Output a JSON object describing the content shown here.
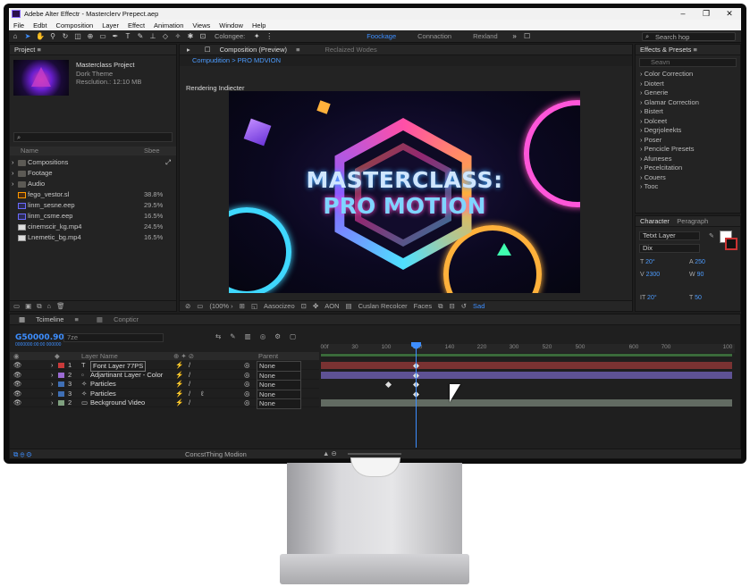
{
  "window": {
    "title": "Adebe Alter Effectr - Masterclerv Prepect.aep"
  },
  "menu": [
    "File",
    "Edbt",
    "Composition",
    "Layer",
    "Effect",
    "Animation",
    "Views",
    "Window",
    "Help"
  ],
  "toolbar": {
    "collapse_label": "Colongee:",
    "workspaces": [
      "Foockage",
      "Connaction",
      "Rexland"
    ],
    "search_help": "Search hop"
  },
  "project": {
    "panel_title": "Project",
    "name": "Masterclass Project",
    "line2": "Dork Theme",
    "line3": "Resclution.: 12:10 MB",
    "search": "",
    "col_name": "Name",
    "col_size": "Sbee",
    "items": [
      {
        "name": "Compositions",
        "size": "",
        "type": "folder"
      },
      {
        "name": "Footage",
        "size": "",
        "type": "folder"
      },
      {
        "name": "Audio",
        "size": "",
        "type": "folder"
      },
      {
        "name": "fego_vestor.sl",
        "size": "38.8%",
        "type": "ai"
      },
      {
        "name": "linm_sesne.eep",
        "size": "29.5%",
        "type": "file"
      },
      {
        "name": "linm_csme.eep",
        "size": "16.5%",
        "type": "file"
      },
      {
        "name": "cinemscir_kg.mp4",
        "size": "24.5%",
        "type": "vid"
      },
      {
        "name": "Lnemetic_bg.mp4",
        "size": "16.5%",
        "type": "vid"
      }
    ]
  },
  "composition": {
    "tab_active": "Composition (Preview)",
    "tab_other": "Reclaized Wodes",
    "breadcrumb": "Compudition > PRO MDVION",
    "render_label": "Rendering Indiecter",
    "viewer_line1": "MASTERCLASS:",
    "viewer_line2": "PRO MOTION",
    "bar": {
      "zoom": "(100% ›",
      "res": "Aasocizeo",
      "mode": "AON",
      "renderer": "Cuslan Recolcer",
      "faces": "Faces",
      "tag": "Sad"
    }
  },
  "effects": {
    "panel_title": "Effects & Presets",
    "search_placeholder": "Seavn",
    "items": [
      "Color Correction",
      "Diotert",
      "Generie",
      "Glamar Correction",
      "Bistert",
      "Dolceet",
      "Degrjoleekts",
      "Poser",
      "Pencicle Presets",
      "Afuneses",
      "Pecelcitation",
      "Couers",
      "Tooc"
    ]
  },
  "character": {
    "tab_active": "Character",
    "tab_other": "Peragraph",
    "font": "Tetxt Layer",
    "style": "Dix",
    "v1": "20°",
    "v2": "250",
    "v3": "2300",
    "v4": "90",
    "v5": "20°",
    "v6": "50"
  },
  "timeline": {
    "tab_active": "Tcimeline",
    "tab_other": "Conpticr",
    "timecode": "G50000.90",
    "timecode_sub": "0000000:00:00 000000",
    "search": "7ze",
    "layer_header": "Layer Name",
    "parent_header": "Parent",
    "bottom_label": "ConcstThing Modion",
    "ticks": [
      "00f",
      "30",
      "100",
      "120",
      "140",
      "220",
      "300",
      "520",
      "500",
      "600",
      "700",
      "100"
    ],
    "layers": [
      {
        "index": "1",
        "name": "Font Layer  77PS",
        "color": "#c83a3a",
        "parent": "None",
        "bar": "#8a3a3a"
      },
      {
        "index": "2",
        "name": "Adjartinant Layer - Color",
        "color": "#9b6bd2",
        "parent": "None",
        "bar": "#5e5294"
      },
      {
        "index": "3",
        "name": "Particles",
        "color": "#3f6fb5",
        "parent": "None",
        "bar": ""
      },
      {
        "index": "3",
        "name": "Particles",
        "color": "#3f6fb5",
        "parent": "None",
        "bar": ""
      },
      {
        "index": "2",
        "name": "Beckground Video",
        "color": "#7fa07f",
        "parent": "None",
        "bar": "#6b7a6b"
      }
    ]
  }
}
